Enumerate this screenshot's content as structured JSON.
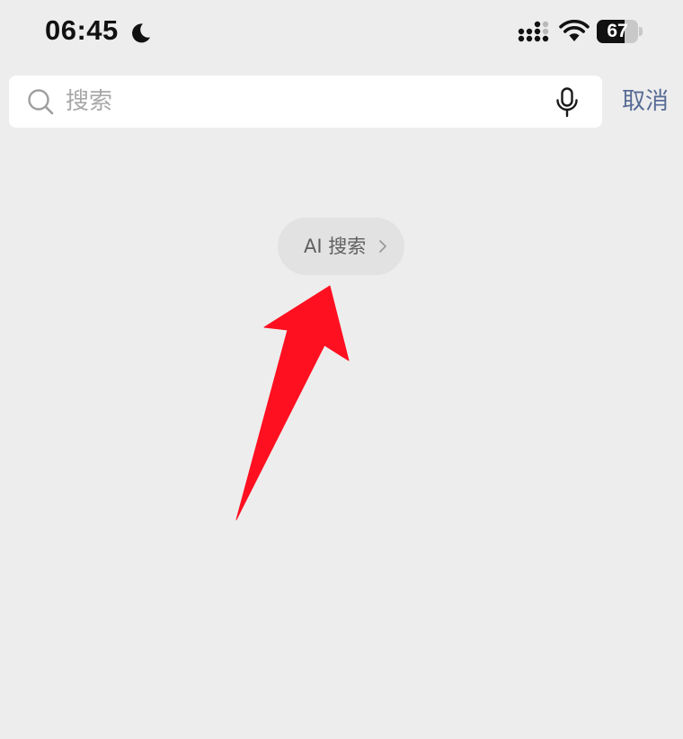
{
  "status_bar": {
    "time": "06:45",
    "battery_level": 67,
    "battery_text": "67",
    "icons": [
      "moon-icon",
      "signal-icon",
      "wifi-icon",
      "battery-icon"
    ]
  },
  "search": {
    "placeholder": "搜索",
    "value": "",
    "icons": [
      "search-icon",
      "mic-icon"
    ]
  },
  "header": {
    "cancel_label": "取消"
  },
  "ai_search": {
    "label": "AI 搜索",
    "icon": "chevron-right-icon"
  },
  "colors": {
    "background": "#ededed",
    "search_box": "#ffffff",
    "cancel_link": "#576b95",
    "pill": "#e2e2e2",
    "annotation_arrow": "#ff1020"
  }
}
